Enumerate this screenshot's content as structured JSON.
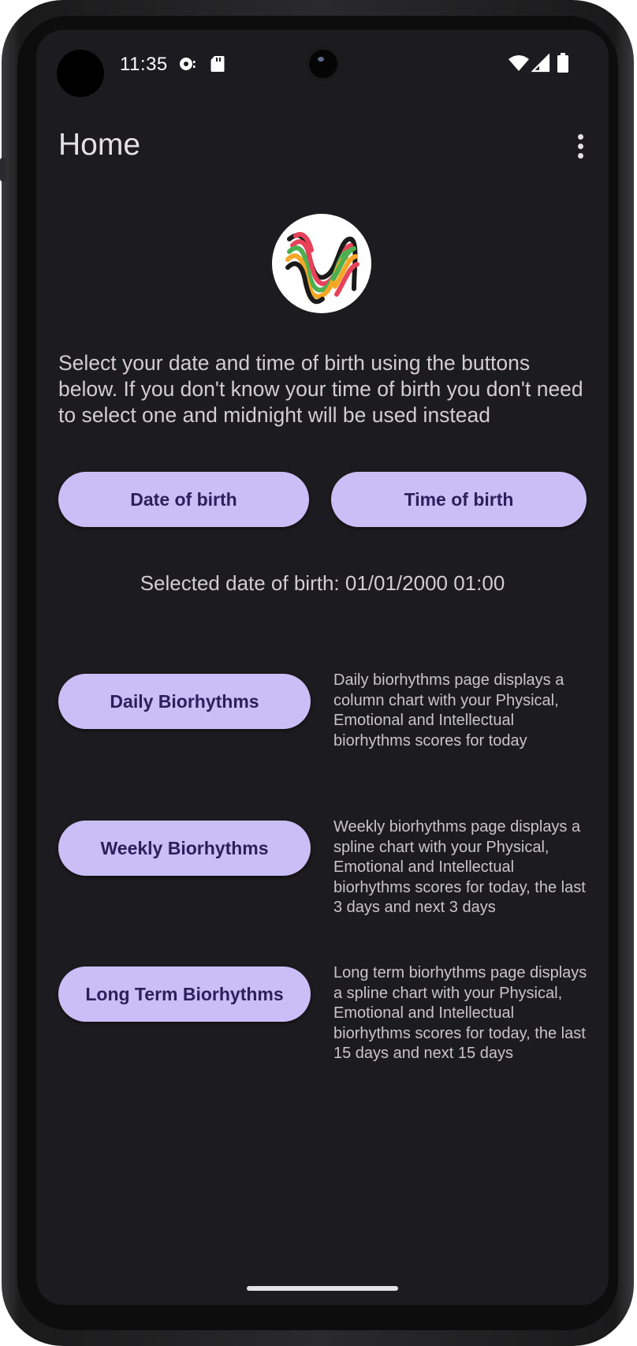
{
  "status_bar": {
    "time": "11:35",
    "icons": [
      "media-icon",
      "sd-card-icon",
      "wifi-icon",
      "signal-icon",
      "battery-icon"
    ]
  },
  "app_bar": {
    "title": "Home",
    "overflow_icon": "more-vert-icon"
  },
  "logo": {
    "icon": "biorhythm-wave-logo",
    "colors": [
      "#e8415a",
      "#4caf50",
      "#f5a623",
      "#1a1a1a"
    ]
  },
  "intro_text": "Select your date and time of birth using the buttons below. If you don't know your time of birth you don't need to select one and midnight will be used instead",
  "buttons": {
    "date_of_birth": "Date of birth",
    "time_of_birth": "Time of birth",
    "daily": "Daily Biorhythms",
    "weekly": "Weekly Biorhythms",
    "long_term": "Long Term Biorhythms"
  },
  "selected_dob": "Selected date of birth: 01/01/2000 01:00",
  "descriptions": {
    "daily": "Daily biorhythms page displays a column chart with your Physical, Emotional and Intellectual biorhythms scores for today",
    "weekly": "Weekly biorhythms page displays a spline chart with your Physical, Emotional and Intellectual biorhythms scores for today, the last 3 days and next 3 days",
    "long_term": "Long term biorhythms page displays a spline chart with your Physical, Emotional and Intellectual biorhythms scores for today, the last 15 days and next 15 days"
  },
  "theme": {
    "background": "#1c1b1f",
    "button": "#cbbef7",
    "button_text": "#2c1f5a",
    "text": "#e6e1e5"
  }
}
